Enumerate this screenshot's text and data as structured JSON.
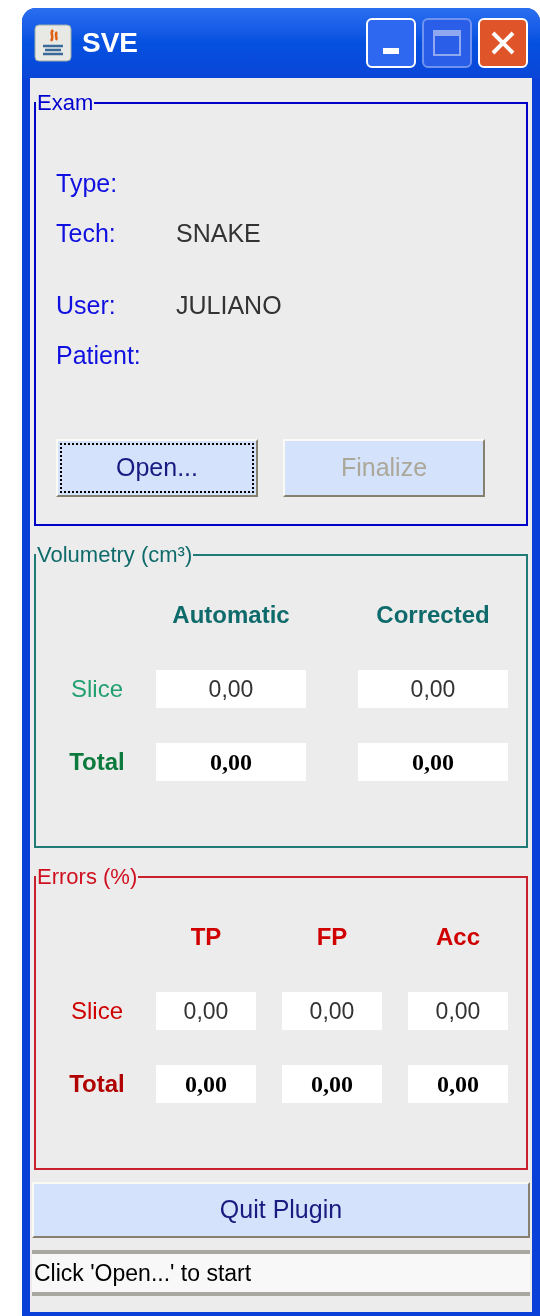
{
  "window": {
    "title": "SVE"
  },
  "exam": {
    "title": "Exam",
    "field_groups": [
      [
        {
          "label": "Type:"
        },
        {
          "label": "Tech:",
          "value": "SNAKE"
        }
      ],
      [
        {
          "label": "User:",
          "value": "JULIANO"
        },
        {
          "label": "Patient:"
        }
      ]
    ],
    "buttons": [
      {
        "label": "Open...",
        "disabled": false,
        "focused": true
      },
      {
        "label": "Finalize",
        "disabled": true,
        "focused": false
      }
    ]
  },
  "volumetry": {
    "title": "Volumetry (cm³)",
    "columns": [
      "Automatic",
      "Corrected"
    ],
    "rows": [
      {
        "label": "Slice",
        "kind": "plain",
        "values": [
          "0,00",
          "0,00"
        ]
      },
      {
        "label": "Total",
        "kind": "total",
        "values": [
          "0,00",
          "0,00"
        ]
      }
    ]
  },
  "errors": {
    "title": "Errors (%)",
    "columns": [
      "TP",
      "FP",
      "Acc"
    ],
    "rows": [
      {
        "label": "Slice",
        "kind": "plain",
        "values": [
          "0,00",
          "0,00",
          "0,00"
        ]
      },
      {
        "label": "Total",
        "kind": "total",
        "values": [
          "0,00",
          "0,00",
          "0,00"
        ]
      }
    ]
  },
  "quit_button": "Quit Plugin",
  "status_bar": "Click 'Open...' to start"
}
